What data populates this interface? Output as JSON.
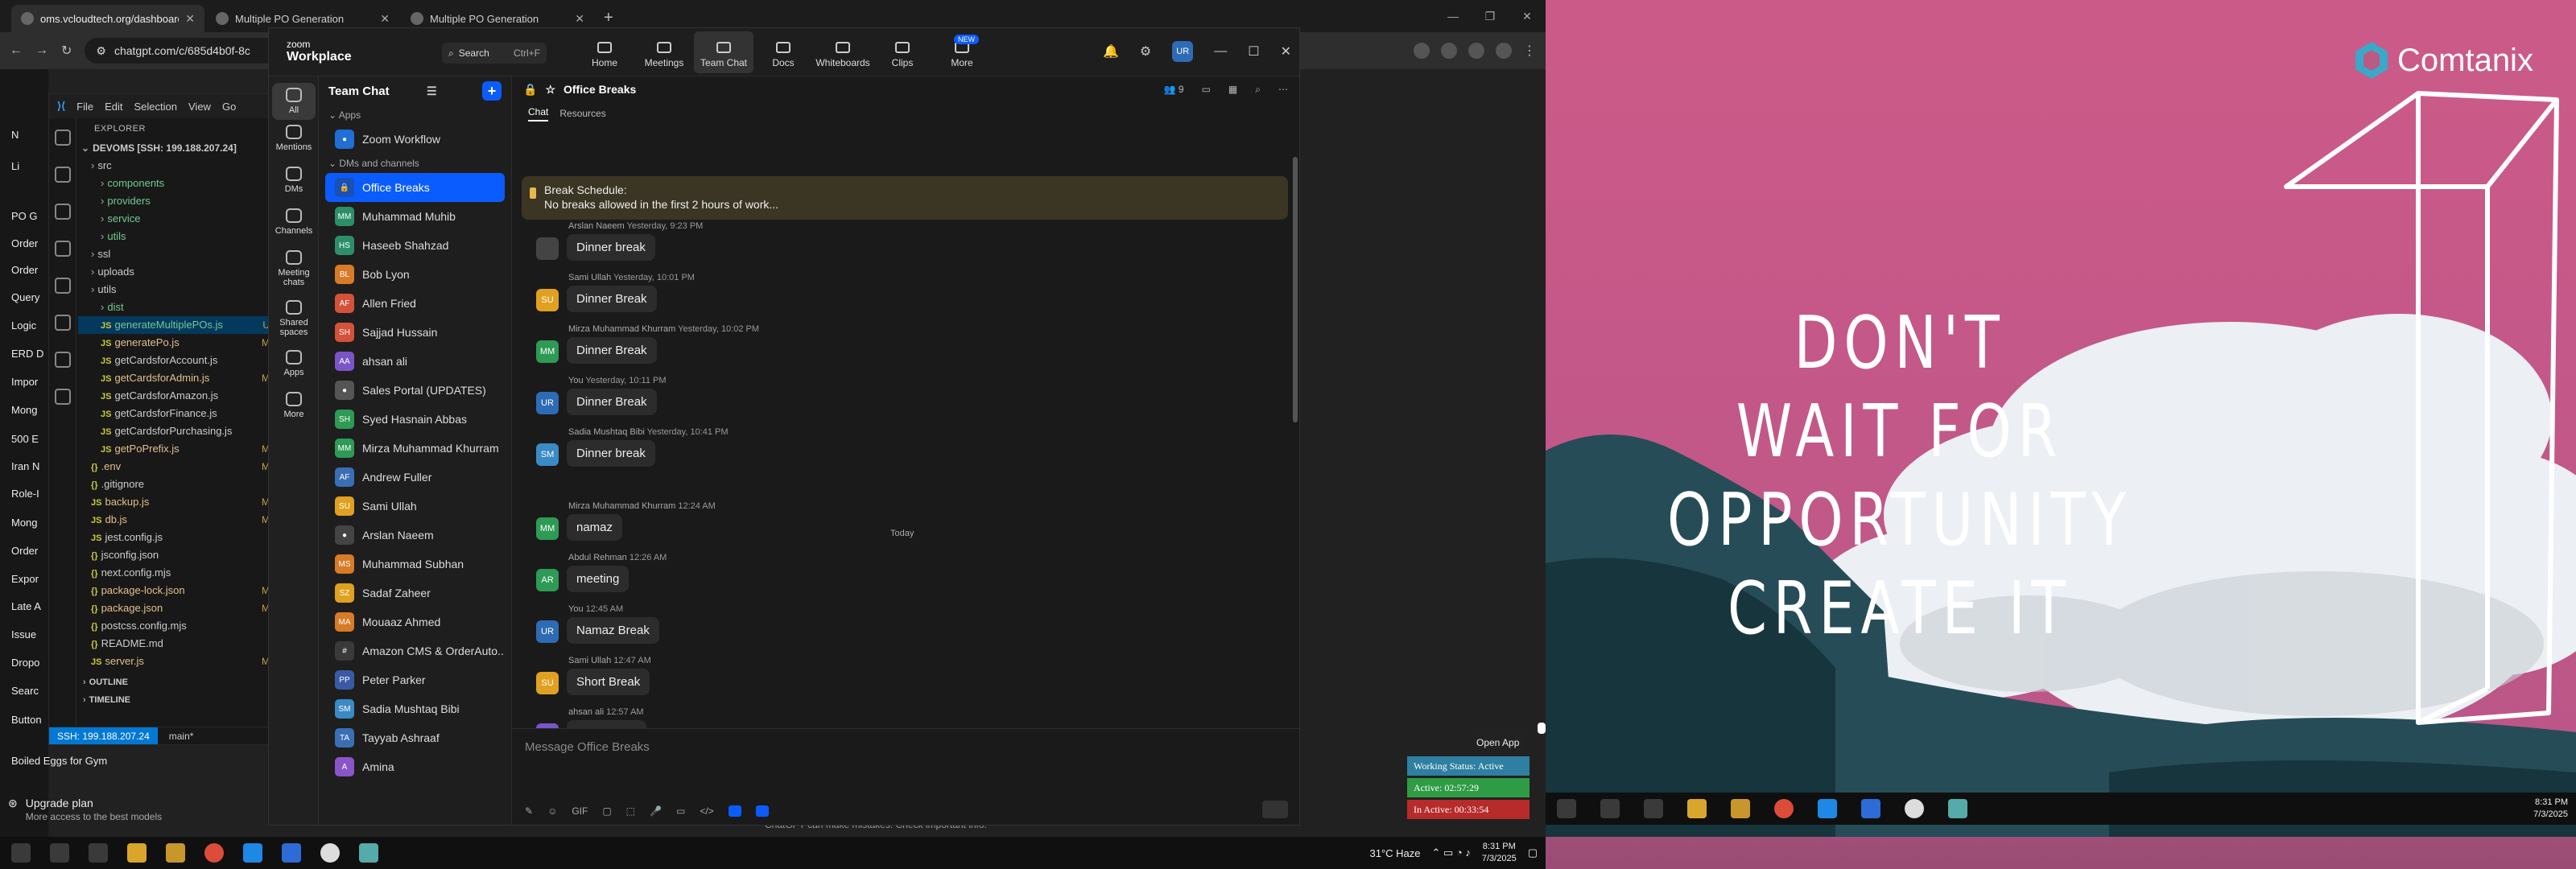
{
  "chrome": {
    "tabs": [
      {
        "label": "oms.vcloudtech.org/dashboard"
      },
      {
        "label": "Multiple PO Generation"
      },
      {
        "label": "Multiple PO Generation"
      }
    ],
    "url": "chatgpt.com/c/685d4b0f-8c"
  },
  "chatgpt": {
    "sidebar_snippets": [
      "N",
      "Li",
      "PO G",
      "Order",
      "Order",
      "Query",
      "Logic",
      "ERD D",
      "Impor",
      "Mong",
      "500 E",
      "Iran N",
      "Role-I",
      "Mong",
      "Order",
      "Expor",
      "Late A",
      "Issue",
      "Dropo",
      "Searc",
      "Button",
      "Boiled Eggs for Gym"
    ],
    "upgrade_title": "Upgrade plan",
    "upgrade_sub": "More access to the best models",
    "disclaimer": "ChatGPT can make mistakes. Check important info."
  },
  "vscode": {
    "menu": [
      "File",
      "Edit",
      "Selection",
      "View",
      "Go"
    ],
    "explorer_title": "EXPLORER",
    "root": "DEVOMS [SSH: 199.188.207.24]",
    "tree": [
      {
        "label": "src",
        "indent": 1,
        "type": "folder",
        "mark": ""
      },
      {
        "label": "components",
        "indent": 2,
        "type": "folder",
        "mark": ""
      },
      {
        "label": "providers",
        "indent": 2,
        "type": "folder",
        "mark": ""
      },
      {
        "label": "service",
        "indent": 2,
        "type": "folder",
        "mark": ""
      },
      {
        "label": "utils",
        "indent": 2,
        "type": "folder",
        "mark": ""
      },
      {
        "label": "ssl",
        "indent": 1,
        "type": "folder",
        "mark": ""
      },
      {
        "label": "uploads",
        "indent": 1,
        "type": "folder",
        "mark": ""
      },
      {
        "label": "utils",
        "indent": 1,
        "type": "folder",
        "mark": ""
      },
      {
        "label": "dist",
        "indent": 2,
        "type": "folder",
        "mark": ""
      },
      {
        "label": "generateMultiplePOs.js",
        "indent": 2,
        "type": "js",
        "mark": "U"
      },
      {
        "label": "generatePo.js",
        "indent": 2,
        "type": "js",
        "mark": "M"
      },
      {
        "label": "getCardsforAccount.js",
        "indent": 2,
        "type": "js",
        "mark": ""
      },
      {
        "label": "getCardsforAdmin.js",
        "indent": 2,
        "type": "js",
        "mark": "M"
      },
      {
        "label": "getCardsforAmazon.js",
        "indent": 2,
        "type": "js",
        "mark": ""
      },
      {
        "label": "getCardsforFinance.js",
        "indent": 2,
        "type": "js",
        "mark": ""
      },
      {
        "label": "getCardsforPurchasing.js",
        "indent": 2,
        "type": "js",
        "mark": ""
      },
      {
        "label": "getPoPrefix.js",
        "indent": 2,
        "type": "js",
        "mark": "M"
      },
      {
        "label": ".env",
        "indent": 1,
        "type": "file",
        "mark": "M"
      },
      {
        "label": ".gitignore",
        "indent": 1,
        "type": "file",
        "mark": ""
      },
      {
        "label": "backup.js",
        "indent": 1,
        "type": "js",
        "mark": "M"
      },
      {
        "label": "db.js",
        "indent": 1,
        "type": "js",
        "mark": "M"
      },
      {
        "label": "jest.config.js",
        "indent": 1,
        "type": "js",
        "mark": ""
      },
      {
        "label": "jsconfig.json",
        "indent": 1,
        "type": "file",
        "mark": ""
      },
      {
        "label": "next.config.mjs",
        "indent": 1,
        "type": "file",
        "mark": ""
      },
      {
        "label": "package-lock.json",
        "indent": 1,
        "type": "file",
        "mark": "M"
      },
      {
        "label": "package.json",
        "indent": 1,
        "type": "file",
        "mark": "M"
      },
      {
        "label": "postcss.config.mjs",
        "indent": 1,
        "type": "file",
        "mark": ""
      },
      {
        "label": "README.md",
        "indent": 1,
        "type": "file",
        "mark": ""
      },
      {
        "label": "server.js",
        "indent": 1,
        "type": "js",
        "mark": "M"
      }
    ],
    "outline": "OUTLINE",
    "timeline": "TIMELINE",
    "status_ssh": "SSH: 199.188.207.24",
    "status_branch": "main*"
  },
  "zoom": {
    "logo_top": "zoom",
    "logo_bottom": "Workplace",
    "search_label": "Search",
    "search_kbd": "Ctrl+F",
    "nav": [
      {
        "label": "Home",
        "badge": ""
      },
      {
        "label": "Meetings",
        "badge": ""
      },
      {
        "label": "Team Chat",
        "badge": ""
      },
      {
        "label": "Docs",
        "badge": ""
      },
      {
        "label": "Whiteboards",
        "badge": ""
      },
      {
        "label": "Clips",
        "badge": ""
      },
      {
        "label": "More",
        "badge": "NEW"
      }
    ],
    "user_initials": "UR",
    "rail": [
      "All",
      "Mentions",
      "DMs",
      "Channels",
      "Meeting chats",
      "Shared spaces",
      "Apps",
      "More"
    ],
    "panel_title": "Team Chat",
    "section_apps": "Apps",
    "section_dms": "DMs and channels",
    "items": [
      {
        "label": "Zoom Workflow",
        "initials": "",
        "color": "#1f6fd6"
      },
      {
        "label": "Office Breaks",
        "initials": "",
        "color": "#1a4fb3"
      },
      {
        "label": "Muhammad Muhib",
        "initials": "MM",
        "color": "#2d8f6a"
      },
      {
        "label": "Haseeb Shahzad",
        "initials": "HS",
        "color": "#2d8f6a"
      },
      {
        "label": "Bob Lyon",
        "initials": "BL",
        "color": "#d87a28"
      },
      {
        "label": "Allen Fried",
        "initials": "AF",
        "color": "#d4513a"
      },
      {
        "label": "Sajjad Hussain",
        "initials": "SH",
        "color": "#d4513a"
      },
      {
        "label": "ahsan ali",
        "initials": "AA",
        "color": "#7a55c8"
      },
      {
        "label": "Sales Portal (UPDATES)",
        "initials": "",
        "color": "#555555"
      },
      {
        "label": "Syed Hasnain Abbas",
        "initials": "SH",
        "color": "#2d9a55"
      },
      {
        "label": "Mirza Muhammad Khurram",
        "initials": "MM",
        "color": "#2d9a55"
      },
      {
        "label": "Andrew Fuller",
        "initials": "AF",
        "color": "#3a6eb5"
      },
      {
        "label": "Sami Ullah",
        "initials": "SU",
        "color": "#e0a020"
      },
      {
        "label": "Arslan Naeem",
        "initials": "",
        "color": "#444444"
      },
      {
        "label": "Muhammad Subhan",
        "initials": "MS",
        "color": "#d87a28"
      },
      {
        "label": "Sadaf Zaheer",
        "initials": "SZ",
        "color": "#e0a020"
      },
      {
        "label": "Mouaaz Ahmed",
        "initials": "MA",
        "color": "#d87a28"
      },
      {
        "label": "Amazon CMS & OrderAuto...",
        "initials": "#",
        "color": "#3a3a3a"
      },
      {
        "label": "Peter Parker",
        "initials": "PP",
        "color": "#3a5aa5"
      },
      {
        "label": "Sadia Mushtaq Bibi",
        "initials": "SM",
        "color": "#3a8ac5"
      },
      {
        "label": "Tayyab Ashraaf",
        "initials": "TA",
        "color": "#3a6eb5"
      },
      {
        "label": "Amina",
        "initials": "A",
        "color": "#8a55c8"
      }
    ],
    "chat_title": "Office Breaks",
    "member_count": "9",
    "tab_chat": "Chat",
    "tab_resources": "Resources",
    "pin_line1": "Break Schedule:",
    "pin_line2": "No breaks allowed in the first 2 hours of work...",
    "today_label": "Today",
    "messages": [
      {
        "name": "Arslan Naeem",
        "time": "Yesterday, 9:23 PM",
        "text": "Dinner break",
        "initials": "",
        "color": "#444444"
      },
      {
        "name": "Sami Ullah",
        "time": "Yesterday, 10:01 PM",
        "text": "Dinner Break",
        "initials": "SU",
        "color": "#e0a020"
      },
      {
        "name": "Mirza Muhammad Khurram",
        "time": "Yesterday, 10:02 PM",
        "text": "Dinner Break",
        "initials": "MM",
        "color": "#2d9a55"
      },
      {
        "name": "You",
        "time": "Yesterday, 10:11 PM",
        "text": "Dinner Break",
        "initials": "UR",
        "color": "#2d6bb5"
      },
      {
        "name": "Sadia Mushtaq Bibi",
        "time": "Yesterday, 10:41 PM",
        "text": "Dinner break",
        "initials": "SM",
        "color": "#3a8ac5"
      },
      {
        "name": "Mirza Muhammad Khurram",
        "time": "12:24 AM",
        "text": "namaz",
        "initials": "MM",
        "color": "#2d9a55"
      },
      {
        "name": "Abdul Rehman",
        "time": "12:26 AM",
        "text": "meeting",
        "initials": "AR",
        "color": "#2d9a55"
      },
      {
        "name": "You",
        "time": "12:45 AM",
        "text": "Namaz Break",
        "initials": "UR",
        "color": "#2d6bb5"
      },
      {
        "name": "Sami Ullah",
        "time": "12:47 AM",
        "text": "Short Break",
        "initials": "SU",
        "color": "#e0a020"
      },
      {
        "name": "ahsan ali",
        "time": "12:57 AM",
        "text": "short break",
        "initials": "AA",
        "color": "#7a55c8"
      }
    ],
    "compose_placeholder": "Message Office Breaks",
    "compose_gif": "GIF"
  },
  "widget": {
    "open_app": "Open App",
    "working_status": "Working Status: Active",
    "active": "Active: 02:57:29",
    "inactive": "In Active: 00:33:54"
  },
  "taskbar_left": {
    "weather": "31°C  Haze",
    "time": "8:31 PM",
    "date": "7/3/2025"
  },
  "wallpaper": {
    "brand": "Comtanix",
    "quote": [
      "DON'T",
      "WAIT FOR",
      "OPPORTUNITY",
      "CREATE IT"
    ]
  },
  "taskbar_right": {
    "time": "8:31 PM",
    "date": "7/3/2025"
  },
  "colors": {
    "zoom_blue": "#0b5cff",
    "vscode_status": "#0078d4",
    "status_active": "#2e9c44",
    "status_inactive": "#b72b2b",
    "status_working": "#2e7fa1"
  }
}
